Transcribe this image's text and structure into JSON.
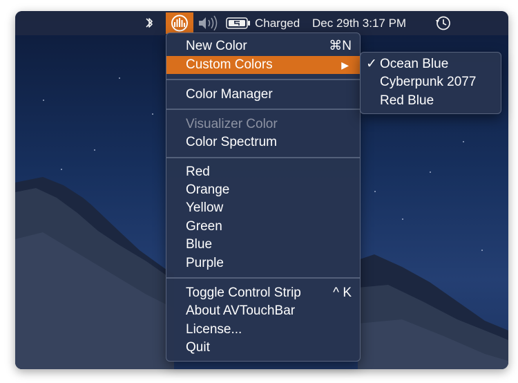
{
  "menubar": {
    "bluetooth_icon": "bluetooth-icon",
    "app_icon": "avtouchbar-icon",
    "volume_icon": "speaker-volume-icon",
    "battery_icon": "battery-charging-icon",
    "battery_status": "Charged",
    "datetime": "Dec 29th 3:17 PM",
    "time_machine_icon": "time-machine-icon"
  },
  "menu": {
    "items": [
      {
        "label": "New Color",
        "shortcut": "⌘N"
      },
      {
        "label": "Custom Colors",
        "shortcut": "▶"
      },
      {
        "label": "Color Manager"
      },
      {
        "label": "Visualizer Color"
      },
      {
        "label": "Color Spectrum"
      },
      {
        "label": "Red"
      },
      {
        "label": "Orange"
      },
      {
        "label": "Yellow"
      },
      {
        "label": "Green"
      },
      {
        "label": "Blue"
      },
      {
        "label": "Purple"
      },
      {
        "label": "Toggle Control Strip",
        "shortcut": "^ K"
      },
      {
        "label": "About AVTouchBar"
      },
      {
        "label": "License..."
      },
      {
        "label": "Quit"
      }
    ]
  },
  "submenu": {
    "checkmark": "✓",
    "items": [
      {
        "label": "Ocean Blue"
      },
      {
        "label": "Cyberpunk 2077"
      },
      {
        "label": "Red Blue"
      }
    ]
  },
  "colors": {
    "highlight": "#d96f1c",
    "menu_background": "#283450",
    "menubar_background": "#1e2842"
  }
}
